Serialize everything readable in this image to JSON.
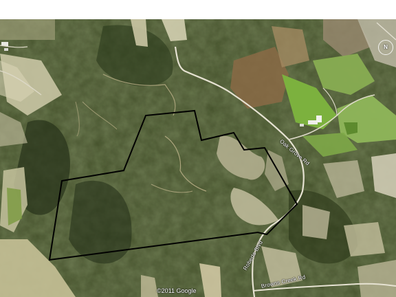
{
  "map": {
    "type": "satellite",
    "roads": {
      "oak_grove": "Oak Grove Rd",
      "roberts": "Roberts Blvd",
      "brown_creek": "Browns Creek Rd"
    },
    "copyright": "©2011 Google",
    "north_label": "N",
    "colors": {
      "forest": "#3d4a24",
      "boundary": "#000000",
      "pasture": "#7aaa3c",
      "road": "#e8e6dc"
    }
  }
}
